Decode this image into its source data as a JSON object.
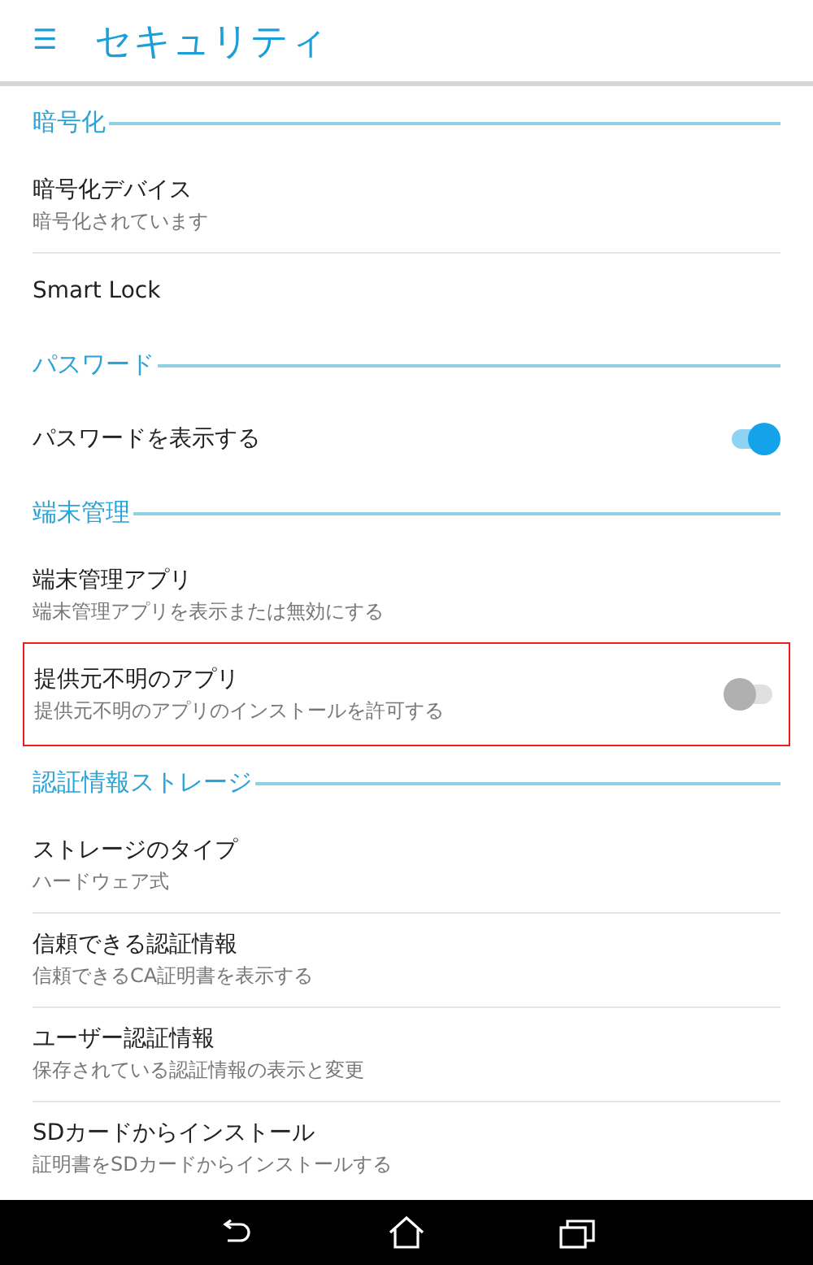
{
  "app_bar": {
    "menu_icon": "☰",
    "title": "セキュリティ"
  },
  "sections": [
    {
      "title": "暗号化",
      "items": [
        {
          "kind": "plain",
          "title": "暗号化デバイス",
          "summary": "暗号化されています"
        },
        {
          "kind": "plain",
          "title": "Smart Lock"
        }
      ]
    },
    {
      "title": "パスワード",
      "items": [
        {
          "kind": "toggle",
          "title": "パスワードを表示する",
          "on": true
        }
      ]
    },
    {
      "title": "端末管理",
      "items": [
        {
          "kind": "plain",
          "title": "端末管理アプリ",
          "summary": "端末管理アプリを表示または無効にする"
        },
        {
          "kind": "toggle",
          "title": "提供元不明のアプリ",
          "summary": "提供元不明のアプリのインストールを許可する",
          "on": false,
          "highlighted": true
        }
      ]
    },
    {
      "title": "認証情報ストレージ",
      "items": [
        {
          "kind": "plain",
          "title": "ストレージのタイプ",
          "summary": "ハードウェア式"
        },
        {
          "kind": "plain",
          "title": "信頼できる認証情報",
          "summary": "信頼できるCA証明書を表示する"
        },
        {
          "kind": "plain",
          "title": "ユーザー認証情報",
          "summary": "保存されている認証情報の表示と変更"
        },
        {
          "kind": "plain",
          "title": "SDカードからインストール",
          "summary": "証明書をSDカードからインストールする"
        }
      ]
    }
  ]
}
